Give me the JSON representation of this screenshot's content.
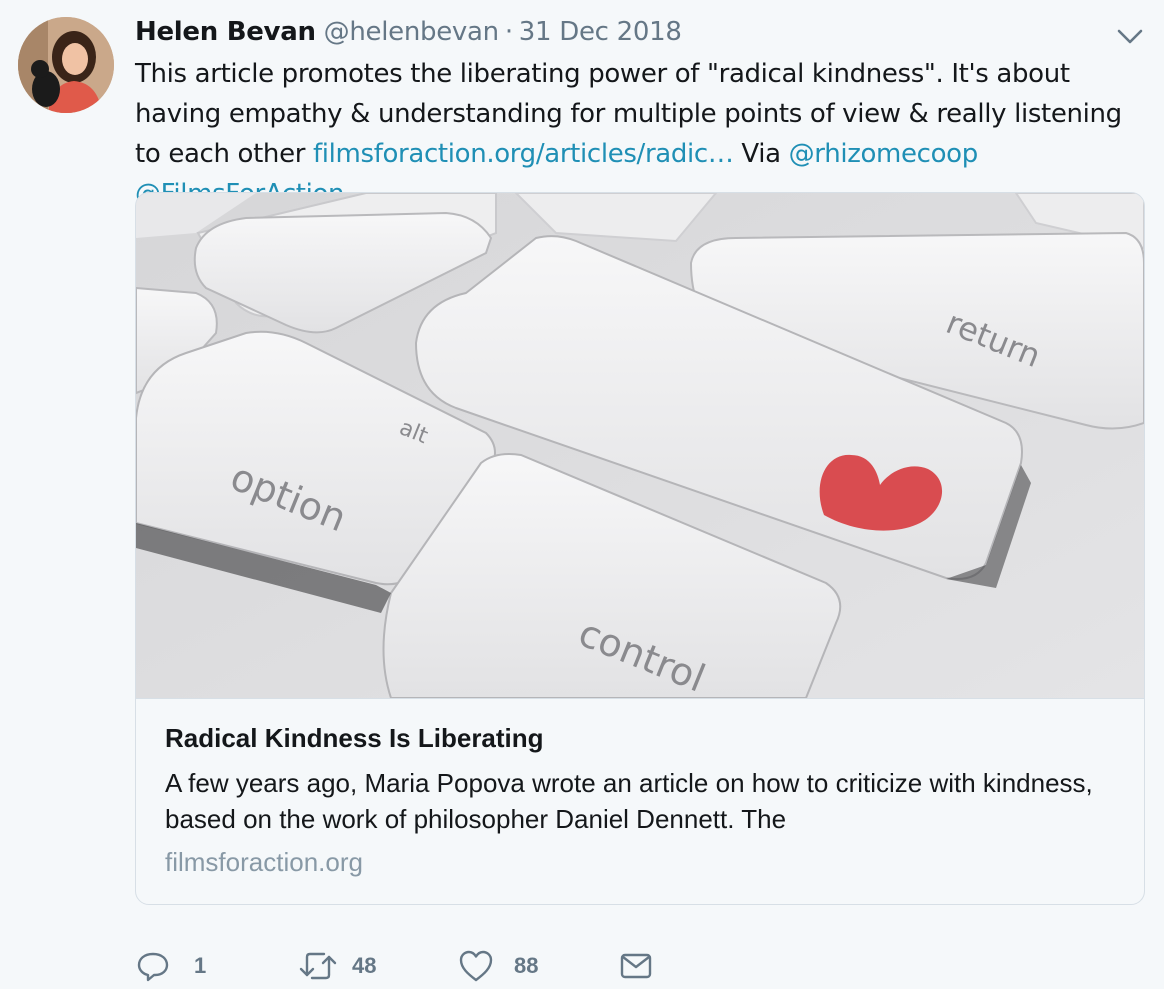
{
  "tweet": {
    "author_name": "Helen Bevan",
    "author_handle": "@helenbevan",
    "separator": "·",
    "date": "31 Dec 2018",
    "text_part1": "This article promotes the liberating power of \"radical kindness\".  It's about having empathy & understanding for multiple points of view & really listening to each other ",
    "link_url": "filmsforaction.org/articles/radic…",
    "text_via": " Via ",
    "mention_1": "@rhizomecoop",
    "text_space": " ",
    "mention_2": "@FilmsForAction"
  },
  "card": {
    "image_keys": {
      "key_option": "option",
      "key_alt": "alt",
      "key_control": "control",
      "key_return": "return"
    },
    "title": "Radical Kindness Is Liberating",
    "description": "A few years ago, Maria Popova wrote an article on how to criticize with kindness, based on the work of philosopher Daniel Dennett.  The",
    "domain": "filmsforaction.org"
  },
  "actions": {
    "reply_count": "1",
    "retweet_count": "48",
    "like_count": "88"
  },
  "icons": {
    "caret": "chevron-down-icon",
    "reply": "reply-icon",
    "retweet": "retweet-icon",
    "like": "heart-icon",
    "message": "envelope-icon",
    "card_heart": "heart-key-icon"
  },
  "colors": {
    "link": "#1f8fb5",
    "muted": "#657786",
    "heart_key": "#d94c50",
    "background": "#f5f8fa"
  }
}
